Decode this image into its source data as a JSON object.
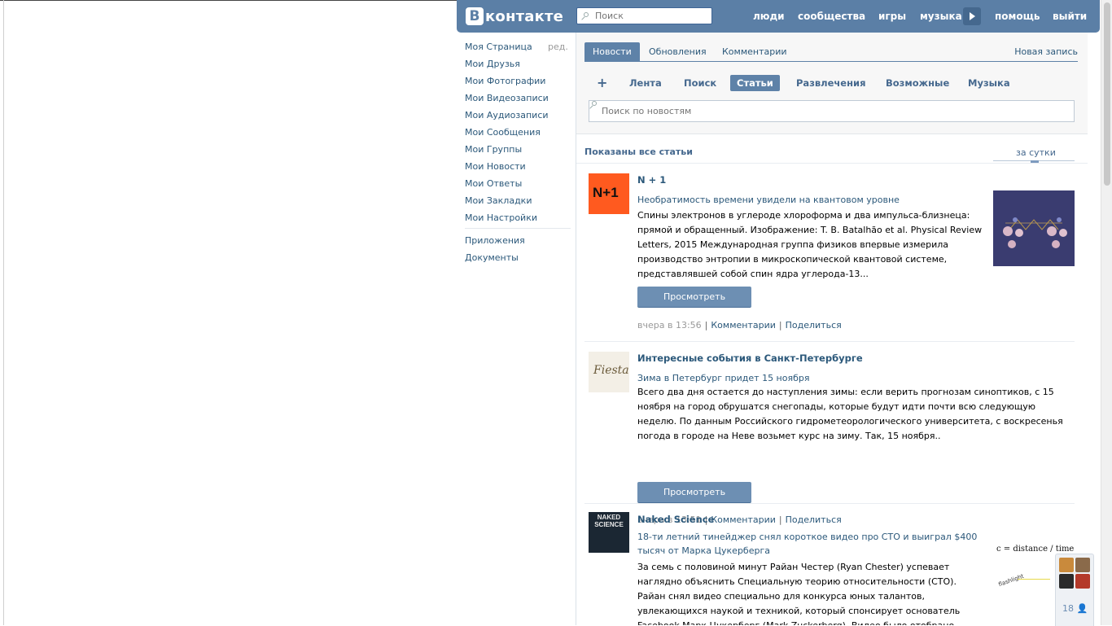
{
  "header": {
    "logo_mark": "В",
    "logo_text": "контакте",
    "search_placeholder": "Поиск",
    "nav": [
      "люди",
      "сообщества",
      "игры",
      "музыка",
      "помощь",
      "выйти"
    ]
  },
  "sidebar": {
    "items": [
      "Моя Страница",
      "Мои Друзья",
      "Мои Фотографии",
      "Мои Видеозаписи",
      "Мои Аудиозаписи",
      "Мои Сообщения",
      "Мои Группы",
      "Мои Новости",
      "Мои Ответы",
      "Мои Закладки",
      "Мои Настройки"
    ],
    "edit_label": "ред.",
    "extra_items": [
      "Приложения",
      "Документы"
    ]
  },
  "tabs": {
    "items": [
      "Новости",
      "Обновления",
      "Комментарии"
    ],
    "new_post": "Новая запись",
    "subtabs": [
      "Лента",
      "Поиск",
      "Статьи",
      "Развлечения",
      "Возможные",
      "Музыка"
    ],
    "add_symbol": "+"
  },
  "news_search": {
    "placeholder": "Поиск по новостям"
  },
  "feed": {
    "shown_label": "Показаны все статьи",
    "period_label": "за сутки",
    "view_button": "Просмотреть",
    "comments_label": "Комментарии",
    "share_label": "Поделиться",
    "separator": "|"
  },
  "posts": [
    {
      "avatar_text": "N+1",
      "title": "N + 1",
      "link": "Необратимость времени увидели на квантовом уровне",
      "text": "Спины электронов в углероде хлороформа и два импульса-близнеца: прямой и обращенный. Изображение: T. B. Batalhão et al. Physical Review Letters, 2015 Международная группа физиков впервые измерила производство энтропии в микроскопической квантовой системе, представлявшей собой спин ядра углерода-13...",
      "time": "вчера в 13:56"
    },
    {
      "avatar_text": "Fiesta",
      "title": "Интересные события в Санкт-Петербурге",
      "link": "Зима в Петербург придет 15 ноября",
      "text": "Всего два дня остается до наступления зимы: если верить прогнозам синоптиков, с 15 ноября на город обрушатся снегопады, которые будут идти почти всю следующую неделю. По данным Российского гидрометеорологического университета, с воскресенья погода в городе на Неве возьмет курс на зиму. Так, 15 ноября..",
      "time": "вчера в 13:51"
    },
    {
      "avatar_text": "NAKED SCIENCE",
      "title": "Naked Science",
      "link": "18-ти летний тинейджер снял короткое видео про СТО и выиграл $400 тысяч от Марка Цукерберга",
      "text": "За семь с половиной минут Райан Честер (Ryan Chester) успевает наглядно объяснить Специальную теорию относительности (СТО).  Райан снял видео специально для конкурса юных талантов, увлекающихся наукой и техникой, который спонсирует основатель Facebook Марк Цукерберг (Mark Zuckerberg). Видео было отобрано...",
      "thumb_text": "c = distance / time",
      "thumb_label": "flashlight"
    }
  ],
  "chat": {
    "count": "18"
  }
}
